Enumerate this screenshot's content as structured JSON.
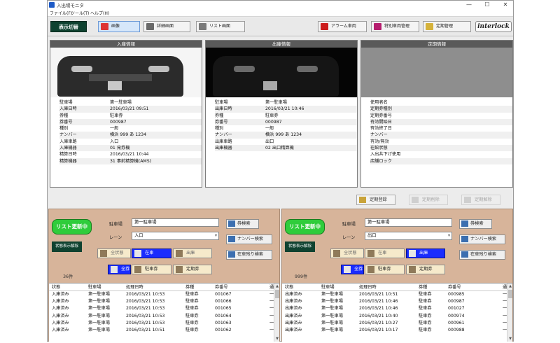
{
  "window": {
    "title": "入出場モニタ",
    "controls": {
      "minimize": "—",
      "maximize": "☐",
      "close": "✕"
    }
  },
  "menu": [
    "ファイル(F)",
    "ツール(T)",
    "ヘルプ(H)"
  ],
  "toolbar": {
    "switch_label": "表示切替",
    "buttons": [
      {
        "label": "画像",
        "icon": "image-icon",
        "selected": true
      },
      {
        "label": "詳細画面",
        "icon": "detail-icon",
        "selected": false
      },
      {
        "label": "リスト画面",
        "icon": "list-icon",
        "selected": false
      },
      {
        "label": "アラーム車両",
        "icon": "alarm-icon",
        "selected": false
      },
      {
        "label": "特別車両管理",
        "icon": "special-vehicle-icon",
        "selected": false
      },
      {
        "label": "定期管理",
        "icon": "pass-icon",
        "selected": false
      }
    ],
    "logo": "interlock"
  },
  "panels": {
    "entry": {
      "title": "入庫情報",
      "rows": [
        {
          "k": "駐車場",
          "v": "第一駐車場"
        },
        {
          "k": "入庫日時",
          "v": "2016/03/21 09:51"
        },
        {
          "k": "券種",
          "v": "駐車券"
        },
        {
          "k": "券番号",
          "v": "000987"
        },
        {
          "k": "種別",
          "v": "一般"
        },
        {
          "k": "ナンバー",
          "v": "横浜 999 あ 1234"
        },
        {
          "k": "入庫車路",
          "v": "入口"
        },
        {
          "k": "入庫機器",
          "v": "01 発券機"
        },
        {
          "k": "精算日時",
          "v": "2016/03/21 10:44"
        },
        {
          "k": "精算機器",
          "v": "31 事前精算機(AMS)"
        }
      ]
    },
    "exit": {
      "title": "出庫情報",
      "rows": [
        {
          "k": "駐車場",
          "v": "第一駐車場"
        },
        {
          "k": "出庫日時",
          "v": "2016/03/21 10:46"
        },
        {
          "k": "券種",
          "v": "駐車券"
        },
        {
          "k": "券番号",
          "v": "000987"
        },
        {
          "k": "種別",
          "v": "一般"
        },
        {
          "k": "ナンバー",
          "v": "横浜 999 あ 1234"
        },
        {
          "k": "出庫車路",
          "v": "出口"
        },
        {
          "k": "出庫機器",
          "v": "02 出口精算機"
        }
      ]
    },
    "pass": {
      "title": "定期情報",
      "rows": [
        {
          "k": "使用者名",
          "v": ""
        },
        {
          "k": "定期券種別",
          "v": ""
        },
        {
          "k": "定期券番号",
          "v": ""
        },
        {
          "k": "有効開始日",
          "v": ""
        },
        {
          "k": "有効終了日",
          "v": ""
        },
        {
          "k": "ナンバー",
          "v": ""
        },
        {
          "k": "有効/無効",
          "v": ""
        },
        {
          "k": "在館状態",
          "v": ""
        },
        {
          "k": "入出共下げ使用",
          "v": ""
        },
        {
          "k": "店舗ロック",
          "v": ""
        }
      ]
    }
  },
  "actions": [
    {
      "label": "定期登録",
      "disabled": false
    },
    {
      "label": "定期削除",
      "disabled": true
    },
    {
      "label": "定期解除",
      "disabled": true
    }
  ],
  "left": {
    "list_update": "リスト更新中",
    "filter_release": "状態表示解除",
    "parking_label": "駐車場",
    "parking_value": "第一駐車場",
    "lane_label": "レーン",
    "lane_value": "入口",
    "ticket_search": "券検索",
    "plate_search": "ナンバー検索",
    "remaining_search": "在車残り検索",
    "status_all": "全状態",
    "status_parked": "在車",
    "status_exit": "出庫",
    "type_all": "全券",
    "type_parking": "駐車券",
    "type_pass": "定期券",
    "count": "36件",
    "columns": [
      "状態",
      "駐車場",
      "処理日時",
      "券種",
      "券番号",
      "通"
    ],
    "rows": [
      [
        "入庫済み",
        "第一駐車場",
        "2016/03/21 10:53",
        "駐車券",
        "001067",
        "一"
      ],
      [
        "入庫済み",
        "第一駐車場",
        "2016/03/21 10:53",
        "駐車券",
        "001066",
        "一"
      ],
      [
        "入庫済み",
        "第一駐車場",
        "2016/03/21 10:53",
        "駐車券",
        "001065",
        "一"
      ],
      [
        "入庫済み",
        "第一駐車場",
        "2016/03/21 10:53",
        "駐車券",
        "001064",
        "一"
      ],
      [
        "入庫済み",
        "第一駐車場",
        "2016/03/21 10:53",
        "駐車券",
        "001063",
        "一"
      ],
      [
        "入庫済み",
        "第一駐車場",
        "2016/03/21 10:51",
        "駐車券",
        "001062",
        "一"
      ]
    ]
  },
  "right": {
    "list_update": "リスト更新中",
    "filter_release": "状態表示解除",
    "parking_label": "駐車場",
    "parking_value": "第一駐車場",
    "lane_label": "レーン",
    "lane_value": "出口",
    "ticket_search": "券検索",
    "plate_search": "ナンバー検索",
    "remaining_search": "在車残り検索",
    "status_all": "全状態",
    "status_parked": "在車",
    "status_exit": "出庫",
    "type_all": "全券",
    "type_parking": "駐車券",
    "type_pass": "定期券",
    "count": "999件",
    "columns": [
      "状態",
      "駐車場",
      "処理日時",
      "券種",
      "券番号",
      "通"
    ],
    "rows": [
      [
        "出庫済み",
        "第一駐車場",
        "2016/03/21 10:51",
        "駐車券",
        "000985",
        "一"
      ],
      [
        "出庫済み",
        "第一駐車場",
        "2016/03/21 10:46",
        "駐車券",
        "000987",
        "一"
      ],
      [
        "出庫済み",
        "第一駐車場",
        "2016/03/21 10:46",
        "駐車券",
        "001027",
        "一"
      ],
      [
        "出庫済み",
        "第一駐車場",
        "2016/03/21 10:40",
        "駐車券",
        "000974",
        "一"
      ],
      [
        "出庫済み",
        "第一駐車場",
        "2016/03/21 10:27",
        "駐車券",
        "000961",
        "一"
      ],
      [
        "出庫済み",
        "第一駐車場",
        "2016/03/21 10:17",
        "駐車券",
        "000988",
        "一"
      ]
    ]
  },
  "colors": {
    "accent_green": "#2fcc3b",
    "dark_green": "#0f4230",
    "select_blue": "#1a2cff",
    "panel_tan": "#d7b49a"
  }
}
